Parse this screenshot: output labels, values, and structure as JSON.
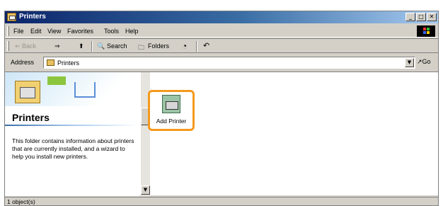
{
  "window": {
    "title": "Printers",
    "controls": {
      "minimize": "_",
      "maximize": "□",
      "close": "✕"
    }
  },
  "menu": [
    "File",
    "Edit",
    "View",
    "Favorites",
    "Tools",
    "Help"
  ],
  "toolbar": {
    "back_label": "⇐ Back",
    "forward_label": "⇒",
    "up_label": "⬆",
    "search_label": "Search",
    "folders_label": "Folders",
    "history_label": "◔",
    "undo_label": "↶"
  },
  "address": {
    "label": "Address",
    "value": "Printers",
    "go_label": "↗Go"
  },
  "left_pane": {
    "title": "Printers",
    "description": "This folder contains information about printers that are currently installed, and a wizard to help you install new printers."
  },
  "items": [
    {
      "label": "Add Printer",
      "icon": "add-printer-icon"
    }
  ],
  "status": {
    "text": "1 object(s)"
  },
  "colors": {
    "highlight": "#f39a1d",
    "titlebar": "#0a246a"
  }
}
